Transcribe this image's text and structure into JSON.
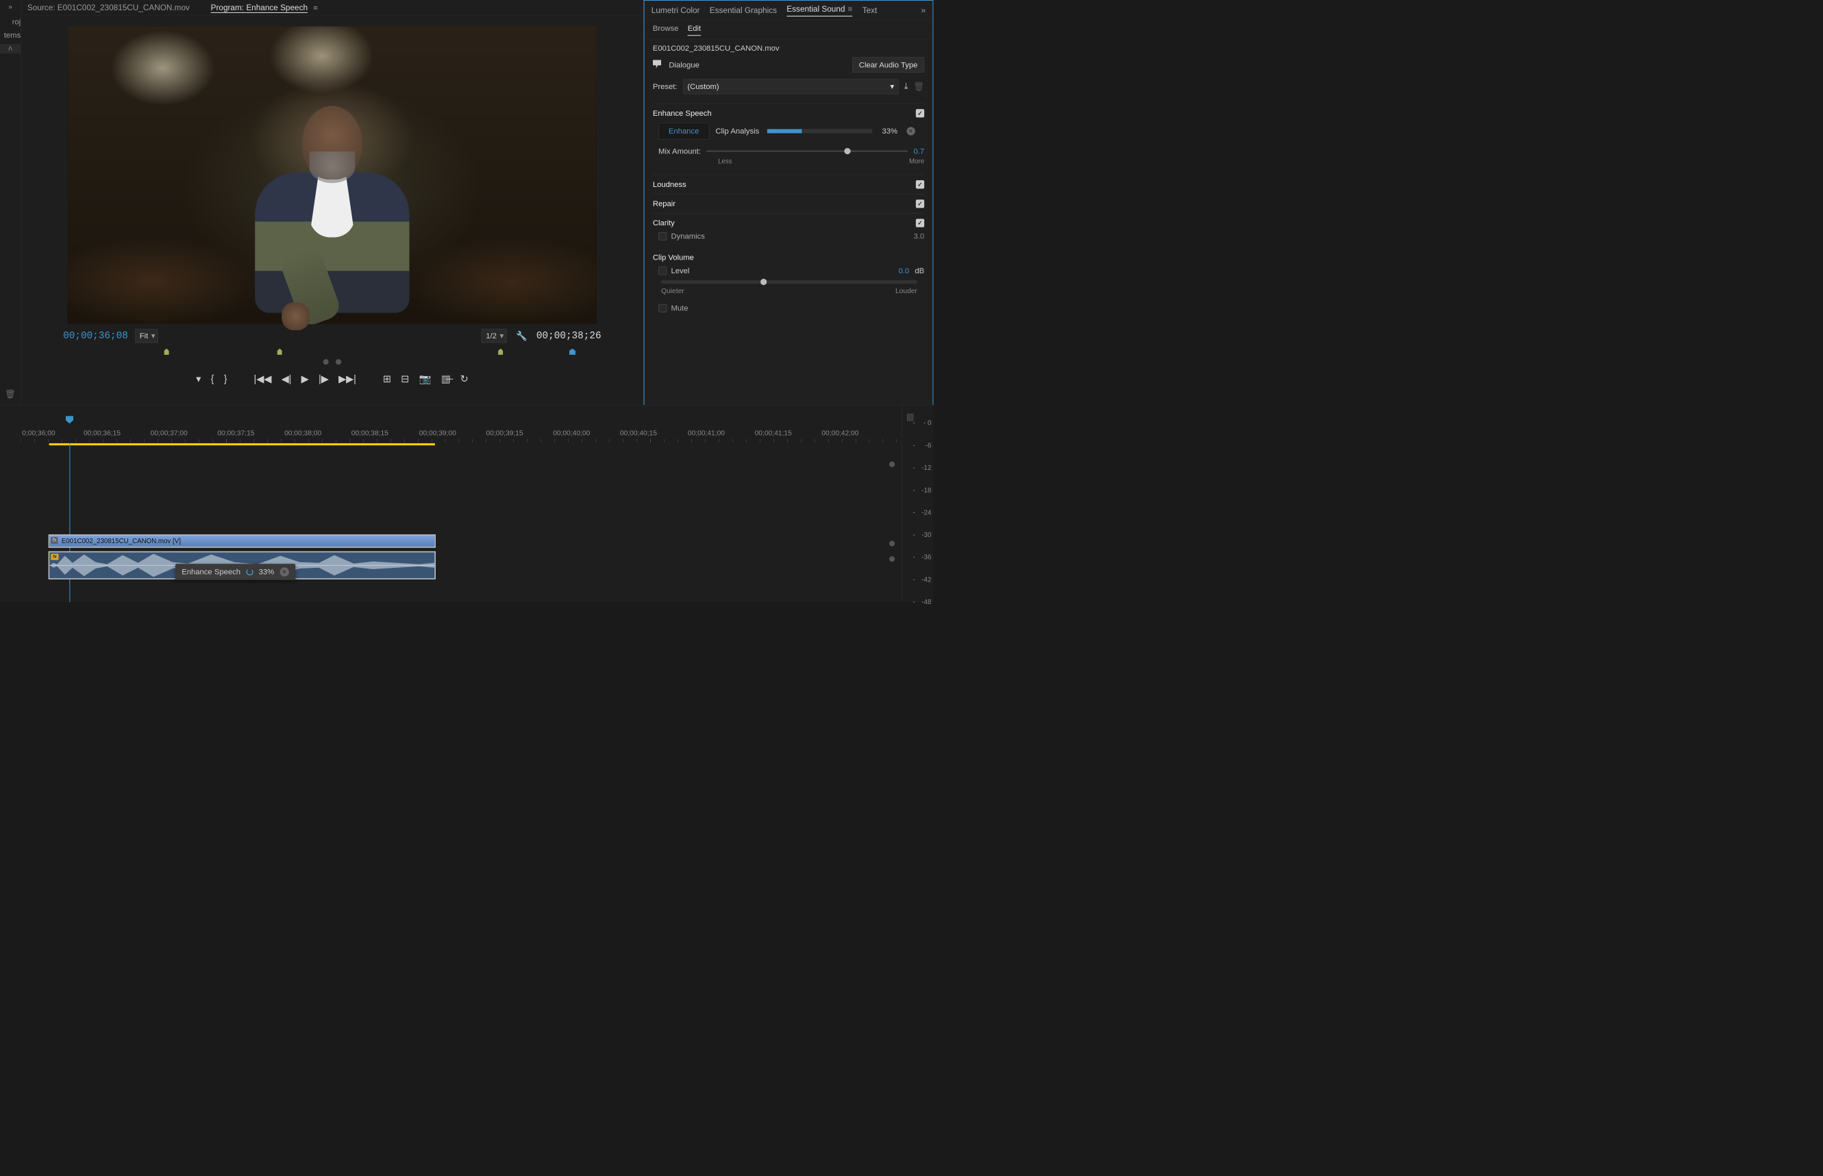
{
  "left": {
    "proj": "roj",
    "items": "tems"
  },
  "tabs": {
    "source_prefix": "Source:",
    "source_file": "E001C002_230815CU_CANON.mov",
    "program_prefix": "Program:",
    "program_name": "Enhance Speech"
  },
  "playback": {
    "tc_left": "00;00;36;08",
    "tc_right": "00;00;38;26",
    "fit_label": "Fit",
    "scale_label": "1/2",
    "markers": [
      {
        "pct": 20,
        "color": "green"
      },
      {
        "pct": 40.5,
        "color": "green"
      },
      {
        "pct": 80.5,
        "color": "green"
      },
      {
        "pct": 93.5,
        "color": "blue"
      }
    ]
  },
  "panel_tabs": {
    "lumetri": "Lumetri Color",
    "graphics": "Essential Graphics",
    "sound": "Essential Sound",
    "text": "Text"
  },
  "subtabs": {
    "browse": "Browse",
    "edit": "Edit"
  },
  "sound": {
    "clip": "E001C002_230815CU_CANON.mov",
    "dialogue": "Dialogue",
    "clear": "Clear Audio Type",
    "preset_label": "Preset:",
    "preset_value": "(Custom)",
    "enhance": {
      "title": "Enhance Speech",
      "btn": "Enhance",
      "clip_analysis": "Clip Analysis",
      "pct": "33%",
      "mix_label": "Mix Amount:",
      "mix_val": "0.7",
      "less": "Less",
      "more": "More"
    },
    "loudness": "Loudness",
    "repair": "Repair",
    "clarity": "Clarity",
    "dynamics": "Dynamics",
    "dynamics_val": "3.0",
    "clip_volume": "Clip Volume",
    "level": "Level",
    "level_val": "0.0",
    "db": "dB",
    "quieter": "Quieter",
    "louder": "Louder",
    "mute": "Mute"
  },
  "timeline": {
    "labels": [
      {
        "t": "0;00;36;00",
        "pct": 2
      },
      {
        "t": "00;00;36;15",
        "pct": 9.2
      },
      {
        "t": "00;00;37;00",
        "pct": 16.8
      },
      {
        "t": "00;00;37;15",
        "pct": 24.4
      },
      {
        "t": "00;00;38;00",
        "pct": 32
      },
      {
        "t": "00;00;38;15",
        "pct": 39.6
      },
      {
        "t": "00;00;39;00",
        "pct": 47.3
      },
      {
        "t": "00;00;39;15",
        "pct": 54.9
      },
      {
        "t": "00;00;40;00",
        "pct": 62.5
      },
      {
        "t": "00;00;40;15",
        "pct": 70.1
      },
      {
        "t": "00;00;41;00",
        "pct": 77.8
      },
      {
        "t": "00;00;41;15",
        "pct": 85.4
      },
      {
        "t": "00;00;42;00",
        "pct": 93
      }
    ],
    "playhead_pct": 5.5,
    "work_start_pct": 3.2,
    "work_end_pct": 47,
    "v_clip": {
      "start_pct": 3.2,
      "end_pct": 47,
      "label": "E001C002_230815CU_CANON.mov [V]"
    },
    "a_clip": {
      "start_pct": 3.2,
      "end_pct": 47
    },
    "tooltip": {
      "label": "Enhance Speech",
      "pct": "33%"
    },
    "meter_ticks": [
      0,
      -6,
      -12,
      -18,
      -24,
      -30,
      -36,
      -42,
      -48
    ]
  }
}
